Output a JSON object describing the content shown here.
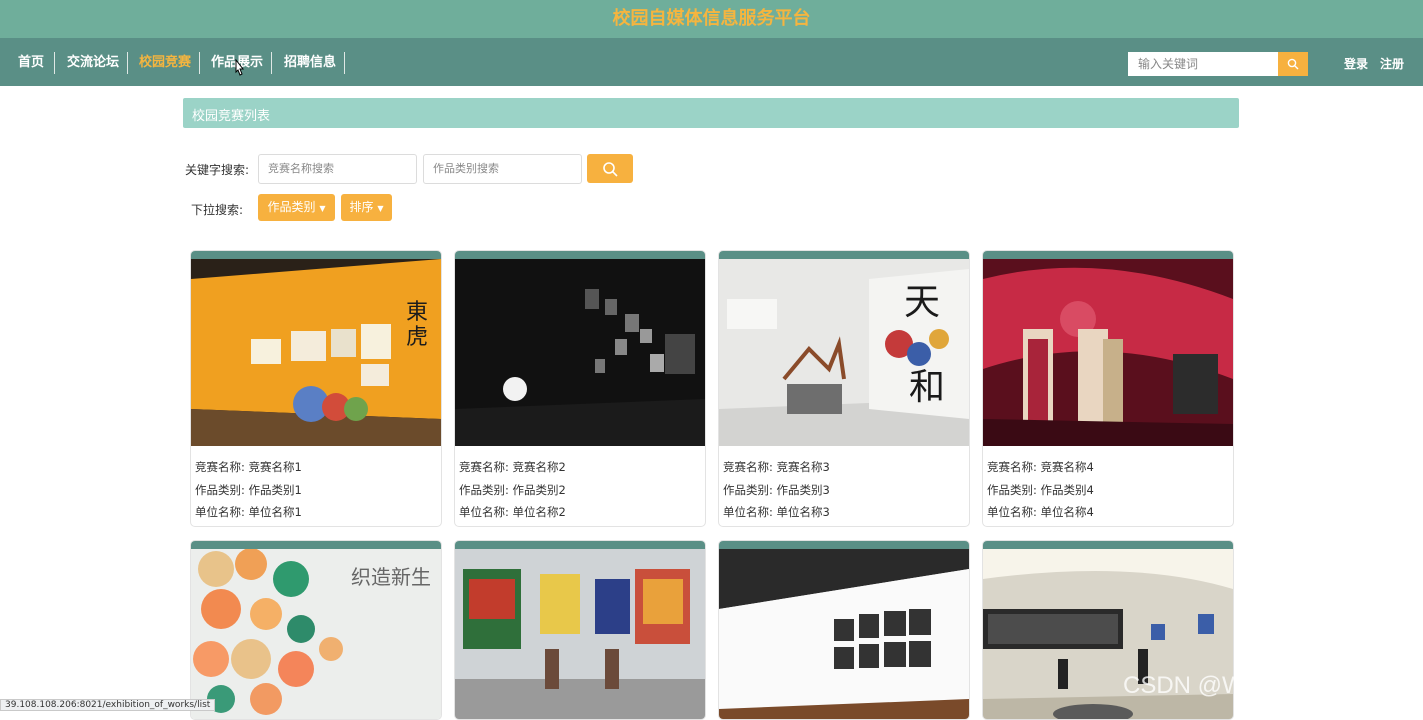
{
  "header": {
    "title": "校园自媒体信息服务平台"
  },
  "nav": {
    "items": [
      {
        "label": "首页"
      },
      {
        "label": "交流论坛"
      },
      {
        "label": "校园竞赛"
      },
      {
        "label": "作品展示"
      },
      {
        "label": "招聘信息"
      }
    ],
    "active_item": "校园竞赛",
    "search_placeholder": "输入关键词",
    "login": "登录",
    "register": "注册"
  },
  "section": {
    "title": "校园竞赛列表"
  },
  "filters": {
    "keyword_label": "关键字搜索:",
    "name_placeholder": "竞赛名称搜索",
    "category_placeholder": "作品类别搜索",
    "dropdown_label": "下拉搜索:",
    "category_dropdown": "作品类别",
    "sort_dropdown": "排序"
  },
  "card_labels": {
    "name": "竞赛名称:",
    "category": "作品类别:",
    "unit": "单位名称:"
  },
  "cards": [
    {
      "name": "竞赛名称1",
      "category": "作品类别1",
      "unit": "单位名称1"
    },
    {
      "name": "竞赛名称2",
      "category": "作品类别2",
      "unit": "单位名称2"
    },
    {
      "name": "竞赛名称3",
      "category": "作品类别3",
      "unit": "单位名称3"
    },
    {
      "name": "竞赛名称4",
      "category": "作品类别4",
      "unit": "单位名称4"
    },
    {},
    {},
    {},
    {}
  ],
  "status_bar": {
    "url": "39.108.108.206:8021/exhibition_of_works/list"
  },
  "watermark": "CSDN @WeiXin_DZbishe",
  "colors": {
    "header_bg": "#6fae9b",
    "nav_bg": "#5a8f86",
    "accent": "#f7b13f",
    "section_bg": "#9bd3c7"
  }
}
